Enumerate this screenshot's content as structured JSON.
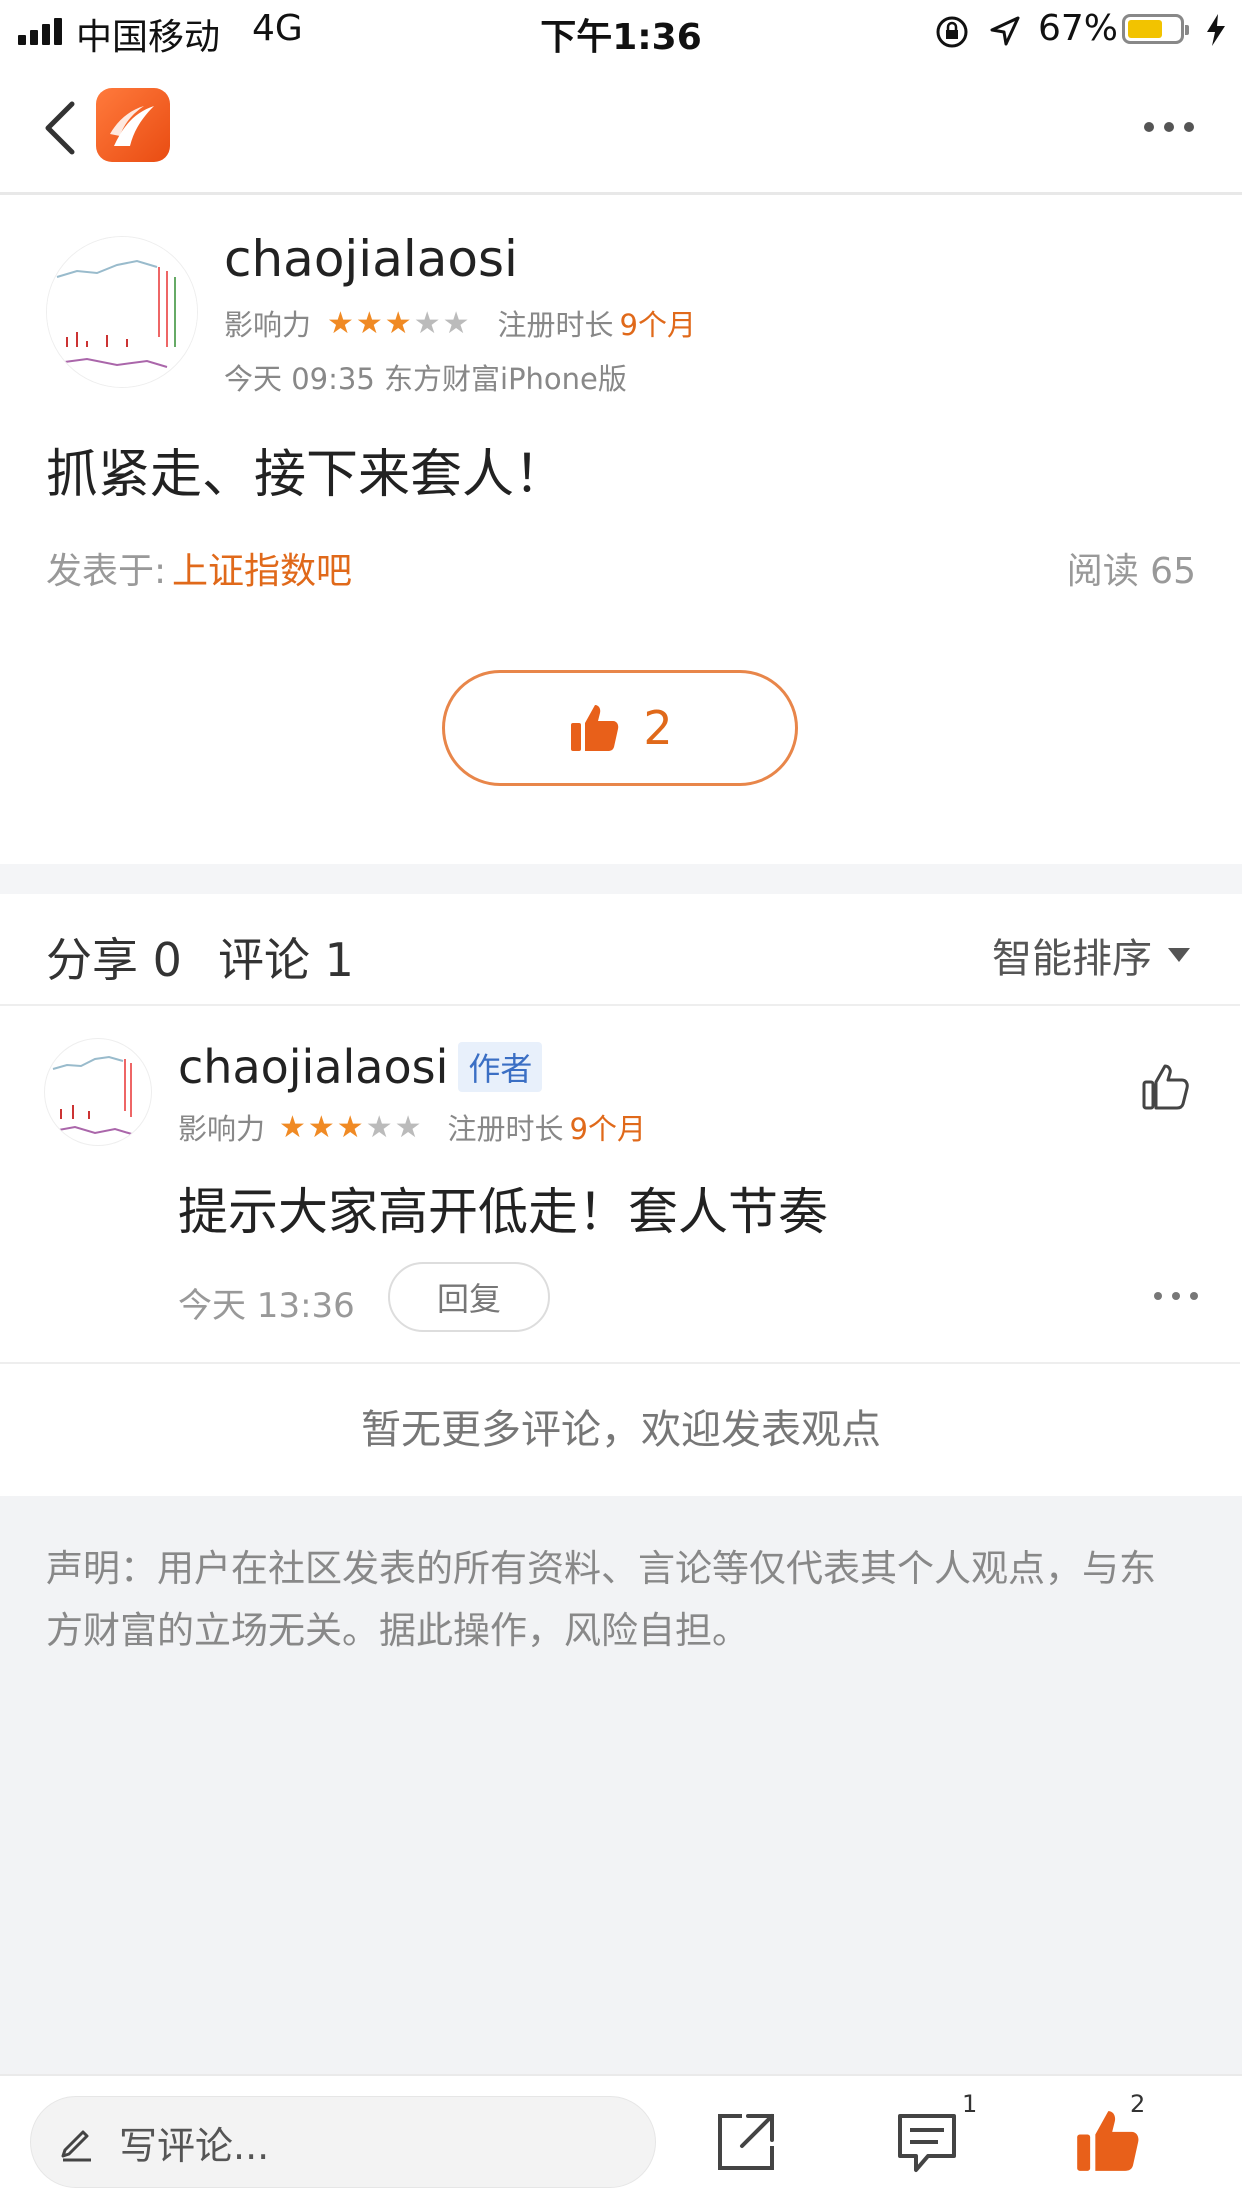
{
  "status_bar": {
    "carrier": "中国移动",
    "network": "4G",
    "time": "下午1:36",
    "battery_percent": "67%",
    "battery_level": 0.67
  },
  "post": {
    "author": "chaojialaosi",
    "influence_label": "影响力",
    "stars_filled": 3,
    "stars_total": 5,
    "reg_label": "注册时长",
    "reg_value": "9个月",
    "time_source": "今天 09:35 东方财富iPhone版",
    "text": "抓紧走、接下来套人！",
    "posted_in_label": "发表于:",
    "forum": "上证指数吧",
    "read_label": "阅读 65",
    "like_count": "2"
  },
  "comments_header": {
    "share": "分享 0",
    "comment": "评论 1",
    "sort": "智能排序"
  },
  "comment": {
    "author": "chaojialaosi",
    "tag": "作者",
    "influence_label": "影响力",
    "reg_label": "注册时长",
    "reg_value": "9个月",
    "text": "提示大家高开低走！套人节奏",
    "time": "今天 13:36",
    "reply": "回复"
  },
  "no_more": "暂无更多评论，欢迎发表观点",
  "disclaimer": "声明：用户在社区发表的所有资料、言论等仅代表其个人观点，与东方财富的立场无关。据此操作，风险自担。",
  "bottom_bar": {
    "placeholder": "写评论...",
    "comment_badge": "1",
    "like_badge": "2"
  },
  "colors": {
    "accent": "#e0691a",
    "star": "#f08a24",
    "tag_blue": "#3b6fc4"
  }
}
